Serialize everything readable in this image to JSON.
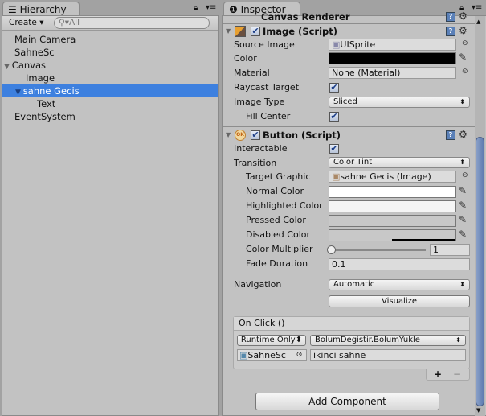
{
  "hierarchy": {
    "tab": "Hierarchy",
    "create": "Create",
    "search_placeholder": "All",
    "items": [
      {
        "label": "Main Camera"
      },
      {
        "label": "SahneSc"
      },
      {
        "label": "Canvas"
      },
      {
        "label": "Image"
      },
      {
        "label": "sahne Gecis"
      },
      {
        "label": "Text"
      },
      {
        "label": "EventSystem"
      }
    ]
  },
  "inspector": {
    "tab": "Inspector",
    "canvas_renderer": "Canvas Renderer",
    "image": {
      "title": "Image (Script)",
      "source_image_label": "Source Image",
      "source_image": "UISprite",
      "color_label": "Color",
      "color": "#000000",
      "material_label": "Material",
      "material": "None (Material)",
      "raycast_label": "Raycast Target",
      "image_type_label": "Image Type",
      "image_type": "Sliced",
      "fill_center_label": "Fill Center"
    },
    "button": {
      "title": "Button (Script)",
      "interactable_label": "Interactable",
      "transition_label": "Transition",
      "transition": "Color Tint",
      "target_graphic_label": "Target Graphic",
      "target_graphic": "sahne Gecis (Image)",
      "normal_label": "Normal Color",
      "highlighted_label": "Highlighted Color",
      "pressed_label": "Pressed Color",
      "disabled_label": "Disabled Color",
      "multiplier_label": "Color Multiplier",
      "multiplier": "1",
      "fade_label": "Fade Duration",
      "fade": "0.1",
      "navigation_label": "Navigation",
      "navigation": "Automatic",
      "visualize": "Visualize",
      "onclick": {
        "header": "On Click ()",
        "runtime": "Runtime Only",
        "function": "BolumDegistir.BolumYukle",
        "object": "SahneSc",
        "argument": "ikinci sahne",
        "plus": "+",
        "minus": "−"
      }
    },
    "add_component": "Add Component"
  }
}
